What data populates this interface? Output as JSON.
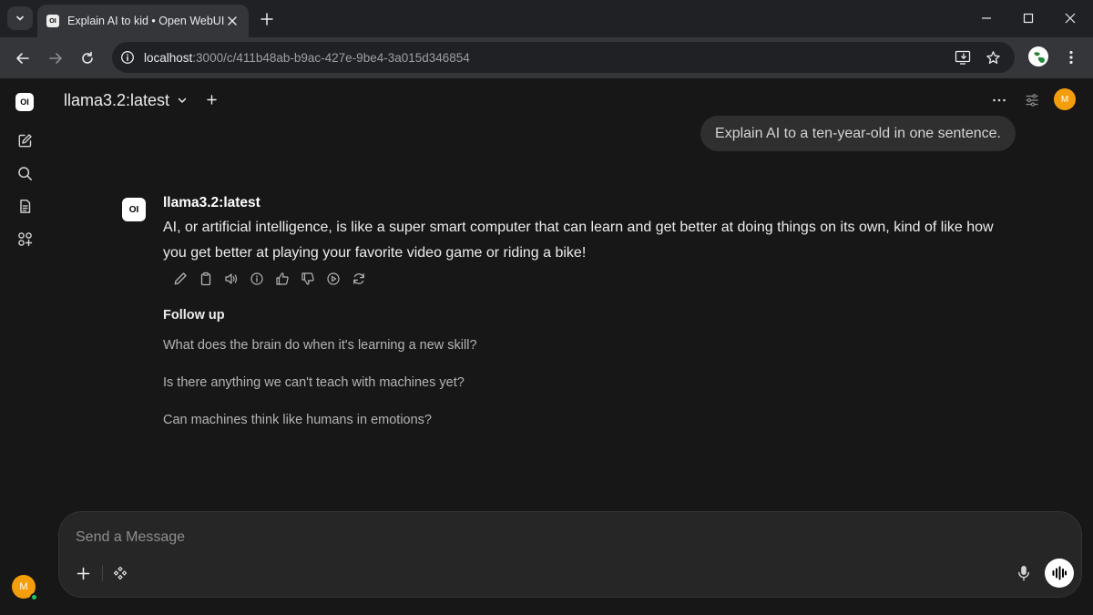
{
  "browser": {
    "tab_title": "Explain AI to kid • Open WebUI",
    "tab_favicon": "OI",
    "url_host": "localhost",
    "url_path": ":3000/c/411b48ab-b9ac-427e-9be4-3a015d346854"
  },
  "sidebar": {
    "logo": "OI",
    "items": [
      {
        "name": "new-chat",
        "icon": "pencil-square-icon"
      },
      {
        "name": "search",
        "icon": "search-icon"
      },
      {
        "name": "notes",
        "icon": "notes-icon"
      },
      {
        "name": "workspace",
        "icon": "apps-icon"
      }
    ],
    "user_initial": "M"
  },
  "header": {
    "model": "llama3.2:latest",
    "user_initial": "M"
  },
  "chat": {
    "user_message": "Explain AI to a ten-year-old in one sentence.",
    "assistant_logo": "OI",
    "assistant_name": "llama3.2:latest",
    "assistant_message": "AI, or artificial intelligence, is like a super smart computer that can learn and get better at doing things on its own, kind of like how you get better at playing your favorite video game or riding a bike!",
    "actions": [
      "edit-icon",
      "copy-icon",
      "read-aloud-icon",
      "info-icon",
      "thumbs-up-icon",
      "thumbs-down-icon",
      "continue-icon",
      "regenerate-icon"
    ],
    "followup_title": "Follow up",
    "followups": [
      "What does the brain do when it's learning a new skill?",
      "Is there anything we can't teach with machines yet?",
      "Can machines think like humans in emotions?"
    ]
  },
  "composer": {
    "placeholder": "Send a Message"
  },
  "colors": {
    "background": "#171717",
    "avatar": "#f59e0b",
    "online": "#22c55e"
  }
}
